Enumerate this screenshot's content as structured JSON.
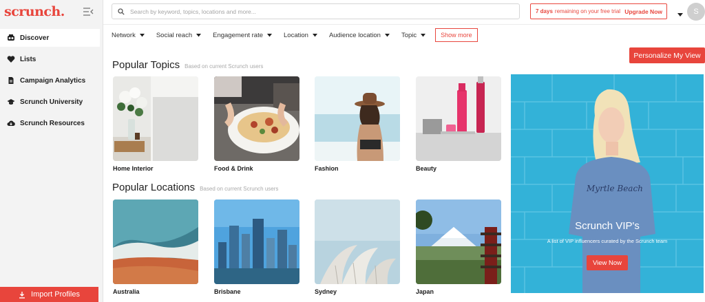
{
  "brand": {
    "logo": "scrunch.",
    "accent": "#e8453c"
  },
  "sidebar": {
    "items": [
      {
        "label": "Discover",
        "icon": "discover-icon",
        "active": true
      },
      {
        "label": "Lists",
        "icon": "heart-icon"
      },
      {
        "label": "Campaign Analytics",
        "icon": "document-icon"
      },
      {
        "label": "Scrunch University",
        "icon": "graduation-cap-icon"
      },
      {
        "label": "Scrunch Resources",
        "icon": "cloud-download-icon"
      }
    ],
    "import_label": "Import Profiles"
  },
  "search": {
    "placeholder": "Search by keyword, topics, locations and more...",
    "value": ""
  },
  "trial": {
    "days": "7 days",
    "text": "remaining on your free trial",
    "upgrade": "Upgrade Now"
  },
  "account": {
    "initial": "S"
  },
  "filters": [
    "Network",
    "Social reach",
    "Engagement rate",
    "Location",
    "Audience location",
    "Topic"
  ],
  "show_more": "Show more",
  "personalize": "Personalize My View",
  "topics": {
    "title": "Popular Topics",
    "subtitle": "Based on current Scrunch users",
    "items": [
      "Home Interior",
      "Food & Drink",
      "Fashion",
      "Beauty"
    ]
  },
  "locations": {
    "title": "Popular Locations",
    "subtitle": "Based on current Scrunch users",
    "items": [
      "Australia",
      "Brisbane",
      "Sydney",
      "Japan"
    ]
  },
  "promo": {
    "title": "Scrunch VIP's",
    "description": "A list of VIP influencers curated by the Scrunch team",
    "button": "View Now"
  }
}
